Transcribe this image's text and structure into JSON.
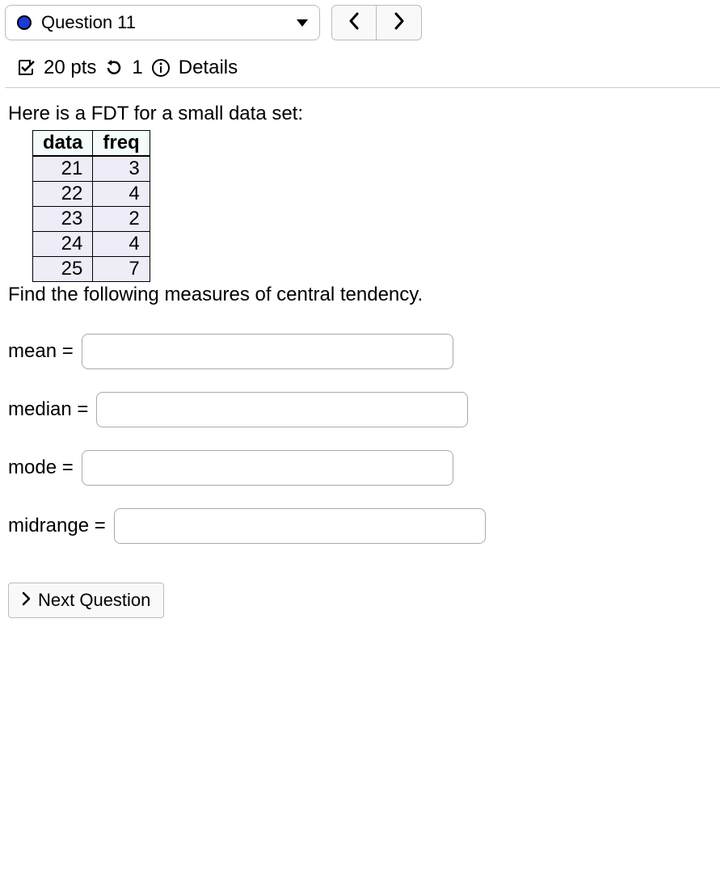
{
  "header": {
    "question_label": "Question 11",
    "prev": "‹",
    "next": "›"
  },
  "meta": {
    "points": "20 pts",
    "attempts": "1",
    "details_label": "Details"
  },
  "problem": {
    "intro": "Here is a FDT for a small data set:",
    "table": {
      "headers": [
        "data",
        "freq"
      ],
      "rows": [
        {
          "data": "21",
          "freq": "3"
        },
        {
          "data": "22",
          "freq": "4"
        },
        {
          "data": "23",
          "freq": "2"
        },
        {
          "data": "24",
          "freq": "4"
        },
        {
          "data": "25",
          "freq": "7"
        }
      ]
    },
    "prompt": "Find the following measures of central tendency."
  },
  "answers": {
    "mean_label": "mean =",
    "median_label": "median =",
    "mode_label": "mode =",
    "midrange_label": "midrange =",
    "mean_value": "",
    "median_value": "",
    "mode_value": "",
    "midrange_value": ""
  },
  "next_question_label": "Next Question"
}
